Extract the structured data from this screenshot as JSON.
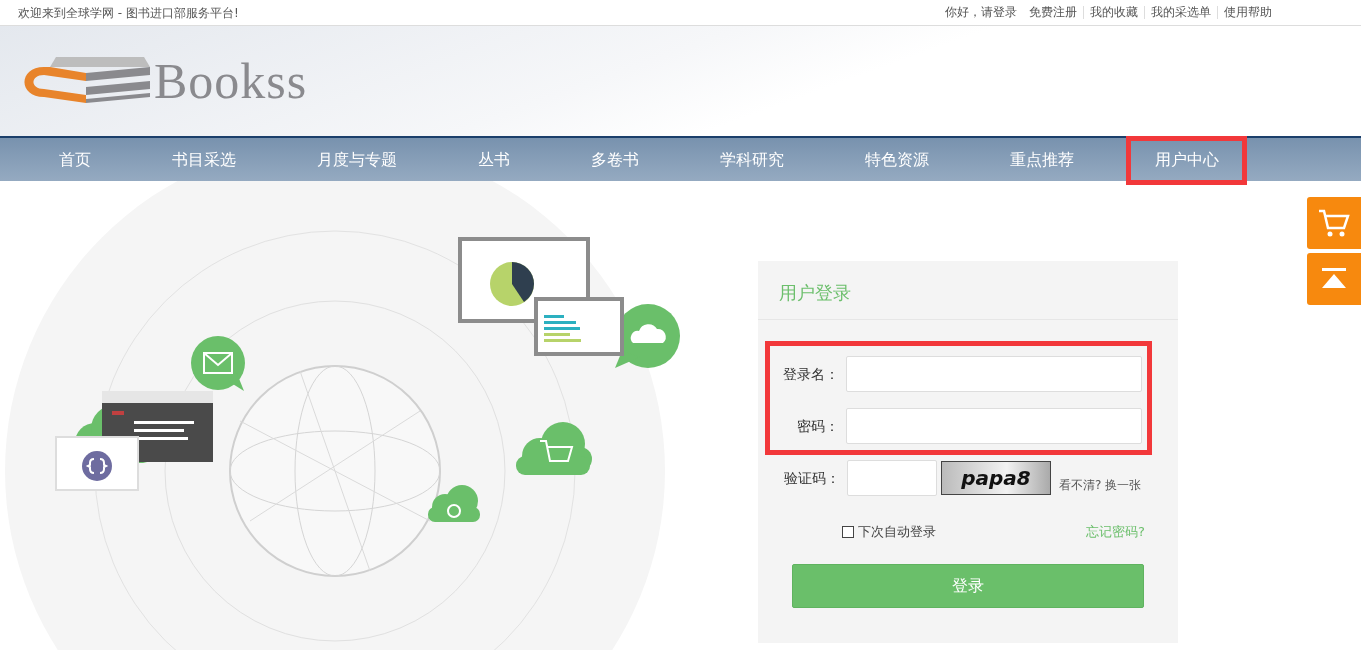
{
  "top_bar": {
    "welcome": "欢迎来到全球学网 - 图书进口部服务平台!",
    "greeting": "你好，请登录",
    "links": [
      "免费注册",
      "我的收藏",
      "我的采选单",
      "使用帮助"
    ]
  },
  "logo": {
    "text": "Bookss"
  },
  "nav": [
    {
      "label": "首页",
      "highlighted": false
    },
    {
      "label": "书目采选",
      "highlighted": false
    },
    {
      "label": "月度与专题",
      "highlighted": false
    },
    {
      "label": "丛书",
      "highlighted": false
    },
    {
      "label": "多卷书",
      "highlighted": false
    },
    {
      "label": "学科研究",
      "highlighted": false
    },
    {
      "label": "特色资源",
      "highlighted": false
    },
    {
      "label": "重点推荐",
      "highlighted": false
    },
    {
      "label": "用户中心",
      "highlighted": true
    }
  ],
  "login": {
    "title": "用户登录",
    "fields_highlighted": true,
    "fields": [
      {
        "label": "登录名："
      },
      {
        "label": "密码："
      }
    ],
    "captcha": {
      "label": "验证码：",
      "code": "papa8",
      "hint": "看不清?",
      "refresh": "换一张"
    },
    "remember": {
      "label": "下次自动登录",
      "checked": false
    },
    "forgot": "忘记密码?",
    "submit": "登录"
  }
}
